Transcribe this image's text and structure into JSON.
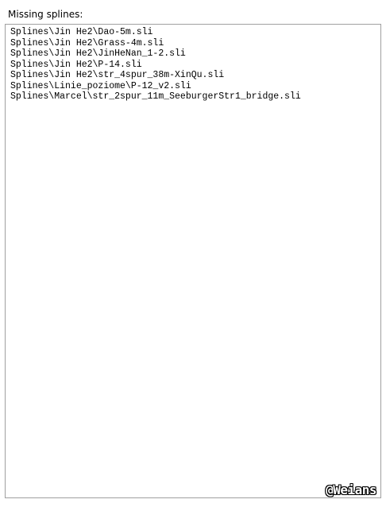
{
  "label": "Missing splines:",
  "missing_splines": [
    "Splines\\Jin He2\\Dao-5m.sli",
    "Splines\\Jin He2\\Grass-4m.sli",
    "Splines\\Jin He2\\JinHeNan_1-2.sli",
    "Splines\\Jin He2\\P-14.sli",
    "Splines\\Jin He2\\str_4spur_38m-XinQu.sli",
    "Splines\\Linie_poziome\\P-12_v2.sli",
    "Splines\\Marcel\\str_2spur_11m_SeeburgerStr1_bridge.sli"
  ],
  "watermark": "@Weians"
}
